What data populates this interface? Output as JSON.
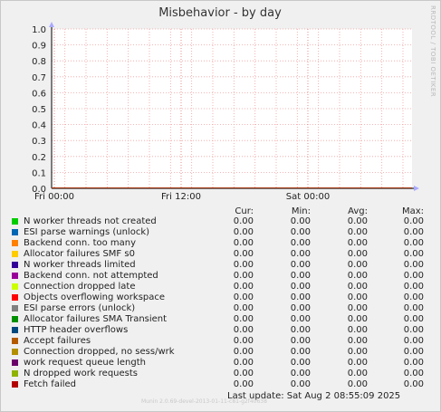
{
  "chart_data": {
    "type": "line",
    "title": "Misbehavior - by day",
    "side_label": "RRDTOOL / TOBI OETIKER",
    "ylim": [
      0,
      1.0
    ],
    "y_ticks": [
      "0.0",
      "0.1",
      "0.2",
      "0.3",
      "0.4",
      "0.5",
      "0.6",
      "0.7",
      "0.8",
      "0.9",
      "1.0"
    ],
    "x_ticks": [
      "Fri 00:00",
      "Fri 12:00",
      "Sat 00:00"
    ],
    "grid": true,
    "legend_placement": "bottom",
    "columns": [
      "Cur:",
      "Min:",
      "Avg:",
      "Max:"
    ],
    "series": [
      {
        "name": "N worker threads not created",
        "color": "#00cc00",
        "values": [
          "0.00",
          "0.00",
          "0.00",
          "0.00"
        ]
      },
      {
        "name": "ESI parse warnings (unlock)",
        "color": "#0066b3",
        "values": [
          "0.00",
          "0.00",
          "0.00",
          "0.00"
        ]
      },
      {
        "name": "Backend conn. too many",
        "color": "#ff8000",
        "values": [
          "0.00",
          "0.00",
          "0.00",
          "0.00"
        ]
      },
      {
        "name": "Allocator failures SMF s0",
        "color": "#ffcc00",
        "values": [
          "0.00",
          "0.00",
          "0.00",
          "0.00"
        ]
      },
      {
        "name": "N worker threads limited",
        "color": "#330099",
        "values": [
          "0.00",
          "0.00",
          "0.00",
          "0.00"
        ]
      },
      {
        "name": "Backend conn. not attempted",
        "color": "#990099",
        "values": [
          "0.00",
          "0.00",
          "0.00",
          "0.00"
        ]
      },
      {
        "name": "Connection dropped late",
        "color": "#ccff00",
        "values": [
          "0.00",
          "0.00",
          "0.00",
          "0.00"
        ]
      },
      {
        "name": "Objects overflowing workspace",
        "color": "#ff0000",
        "values": [
          "0.00",
          "0.00",
          "0.00",
          "0.00"
        ]
      },
      {
        "name": "ESI parse errors (unlock)",
        "color": "#808080",
        "values": [
          "0.00",
          "0.00",
          "0.00",
          "0.00"
        ]
      },
      {
        "name": "Allocator failures SMA Transient",
        "color": "#008f00",
        "values": [
          "0.00",
          "0.00",
          "0.00",
          "0.00"
        ]
      },
      {
        "name": "HTTP header overflows",
        "color": "#00487d",
        "values": [
          "0.00",
          "0.00",
          "0.00",
          "0.00"
        ]
      },
      {
        "name": "Accept failures",
        "color": "#b35a00",
        "values": [
          "0.00",
          "0.00",
          "0.00",
          "0.00"
        ]
      },
      {
        "name": "Connection dropped, no sess/wrk",
        "color": "#b38f00",
        "values": [
          "0.00",
          "0.00",
          "0.00",
          "0.00"
        ]
      },
      {
        "name": "work request queue length",
        "color": "#6b006b",
        "values": [
          "0.00",
          "0.00",
          "0.00",
          "0.00"
        ]
      },
      {
        "name": "N dropped work requests",
        "color": "#8fb300",
        "values": [
          "0.00",
          "0.00",
          "0.00",
          "0.00"
        ]
      },
      {
        "name": "Fetch failed",
        "color": "#b30000",
        "values": [
          "0.00",
          "0.00",
          "0.00",
          "0.00"
        ]
      }
    ],
    "last_update": "Last update:  Sat Aug  2 08:55:09 2025",
    "footer": "Munin 2.0.69-devel-2013-01-11-c81-g2f40638"
  }
}
